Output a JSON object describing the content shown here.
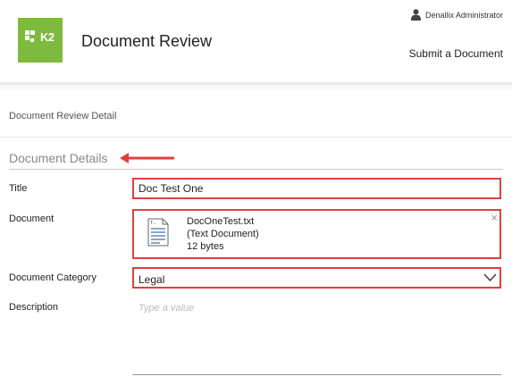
{
  "header": {
    "app_title": "Document Review",
    "logo_text": "K2",
    "user_name": "Denallix Administrator",
    "submit_link": "Submit a Document"
  },
  "section": {
    "title": "Document Review Detail"
  },
  "form": {
    "group_title": "Document Details",
    "title_label": "Title",
    "title_value": "Doc Test One",
    "document_label": "Document",
    "document": {
      "file_name": "DocOneTest.txt",
      "file_type": "(Text Document)",
      "file_size": "12 bytes",
      "remove_glyph": "×",
      "icon_label": "T..."
    },
    "category_label": "Document Category",
    "category_value": "Legal",
    "description_label": "Description",
    "description_placeholder": "Type a value"
  },
  "colors": {
    "brand_green": "#7dba3e",
    "highlight_red": "#e04040"
  }
}
